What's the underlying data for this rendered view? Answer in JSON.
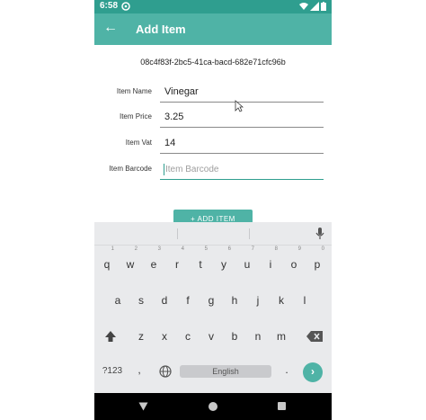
{
  "status_bar": {
    "time": "6:58"
  },
  "app_bar": {
    "title": "Add Item"
  },
  "item_id": "08c4f83f-2bc5-41ca-bacd-682e71cfc96b",
  "form": {
    "name": {
      "label": "Item Name",
      "value": "Vinegar"
    },
    "price": {
      "label": "Item Price",
      "value": "3.25"
    },
    "vat": {
      "label": "Item Vat",
      "value": "14"
    },
    "barcode": {
      "label": "Item Barcode",
      "placeholder": "Item Barcode"
    }
  },
  "add_button": {
    "label": "+ ADD ITEM"
  },
  "keyboard": {
    "row1": [
      "q",
      "w",
      "e",
      "r",
      "t",
      "y",
      "u",
      "i",
      "o",
      "p"
    ],
    "row1_hints": [
      "1",
      "2",
      "3",
      "4",
      "5",
      "6",
      "7",
      "8",
      "9",
      "0"
    ],
    "row2": [
      "a",
      "s",
      "d",
      "f",
      "g",
      "h",
      "j",
      "k",
      "l"
    ],
    "row3": [
      "z",
      "x",
      "c",
      "v",
      "b",
      "n",
      "m"
    ],
    "symbols_label": "?123",
    "comma": ",",
    "space_label": "English",
    "period": "."
  },
  "colors": {
    "primary": "#4fb3a6",
    "primary_dark": "#2f9e8f"
  }
}
